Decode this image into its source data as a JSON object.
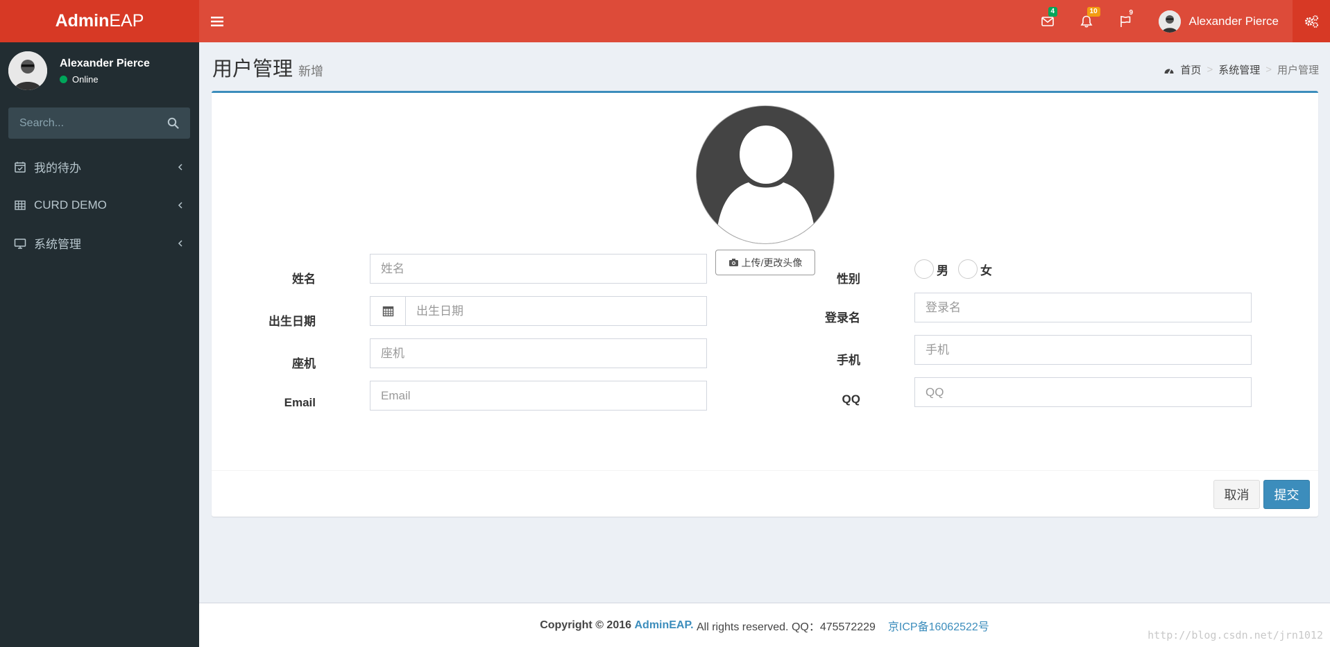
{
  "logo": {
    "bold": "Admin",
    "light": "EAP"
  },
  "navbar": {
    "mail_badge": "4",
    "bell_badge": "10",
    "flag_badge": "9",
    "user_name": "Alexander Pierce"
  },
  "sidebar": {
    "user_name": "Alexander Pierce",
    "status": "Online",
    "search_placeholder": "Search...",
    "items": [
      {
        "label": "我的待办",
        "icon": "calendar-check-icon"
      },
      {
        "label": "CURD DEMO",
        "icon": "table-icon"
      },
      {
        "label": "系统管理",
        "icon": "desktop-icon"
      }
    ]
  },
  "content": {
    "title": "用户管理",
    "subtitle": "新增",
    "breadcrumb": [
      "首页",
      "系统管理",
      "用户管理"
    ]
  },
  "form": {
    "upload_label": "上传/更改头像",
    "name_label": "姓名",
    "name_placeholder": "姓名",
    "birth_label": "出生日期",
    "birth_placeholder": "出生日期",
    "phone_label": "座机",
    "phone_placeholder": "座机",
    "email_label": "Email",
    "email_placeholder": "Email",
    "gender_label": "性别",
    "gender_male": "男",
    "gender_female": "女",
    "login_label": "登录名",
    "login_placeholder": "登录名",
    "mobile_label": "手机",
    "mobile_placeholder": "手机",
    "qq_label": "QQ",
    "qq_placeholder": "QQ",
    "cancel": "取消",
    "submit": "提交"
  },
  "footer": {
    "copyright": "Copyright © 2016",
    "brand": "AdminEAP.",
    "rights": "All rights reserved. QQ：475572229",
    "icp": "京ICP备16062522号",
    "watermark": "http://blog.csdn.net/jrn1012"
  },
  "colors": {
    "header": "#dd4b39",
    "logo": "#d73925",
    "sidebar": "#222d32",
    "primary": "#3c8dbc"
  }
}
